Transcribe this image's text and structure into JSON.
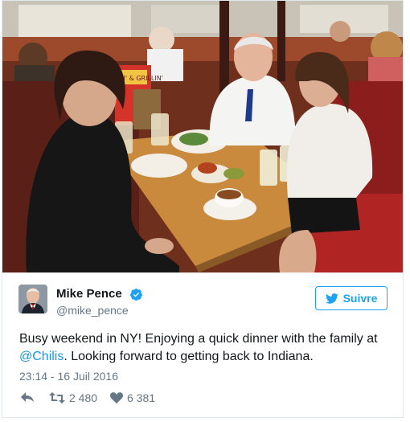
{
  "tweet": {
    "author_name": "Mike Pence",
    "handle": "@mike_pence",
    "follow_label": "Suivre",
    "text_before": "Busy weekend in NY! Enjoying a quick dinner with the family at ",
    "mention": "@Chilis",
    "text_after": ". Looking forward to getting back to Indiana.",
    "timestamp": "23:14 - 16 Juil 2016",
    "retweet_count": "2 480",
    "like_count": "6 381"
  },
  "photo": {
    "menu_text": "CHILIN' & GRILLIN'"
  },
  "icons": {
    "verified": "verified-badge-icon",
    "bird": "twitter-bird-icon",
    "reply": "reply-arrow-icon",
    "retweet": "retweet-icon",
    "like": "heart-icon"
  },
  "colors": {
    "accent": "#1da1f2",
    "link": "#1b95e0",
    "muted": "#657786",
    "text": "#14171a"
  }
}
